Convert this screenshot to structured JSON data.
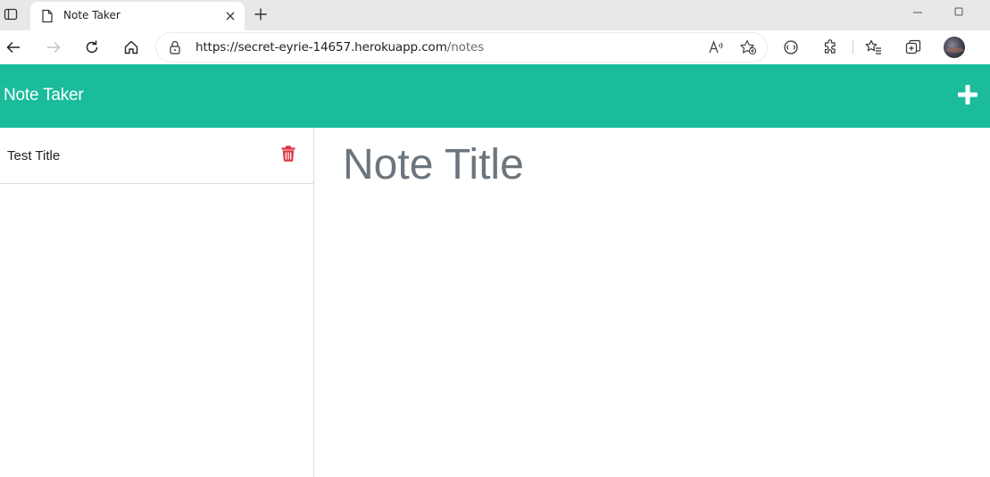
{
  "browser": {
    "tab": {
      "title": "Note Taker"
    },
    "address": {
      "host": "https://secret-eyrie-14657.herokuapp.com",
      "path": "/notes"
    },
    "icons": [
      "tab-actions-icon",
      "page-icon",
      "close-icon",
      "plus-icon",
      "minimize-icon",
      "maximize-icon",
      "back-icon",
      "forward-icon",
      "refresh-icon",
      "home-icon",
      "lock-icon",
      "read-aloud-icon",
      "add-favorite-icon",
      "immersive-reader-icon",
      "extensions-icon",
      "favorites-icon",
      "collections-icon",
      "profile-avatar"
    ]
  },
  "app": {
    "brand": "Note Taker",
    "colors": {
      "header": "#1abc9c",
      "delete": "#dc3545",
      "title_text": "#6c757d"
    },
    "notes": [
      {
        "title": "Test Title"
      }
    ],
    "editor": {
      "title_placeholder": "Note Title"
    }
  }
}
